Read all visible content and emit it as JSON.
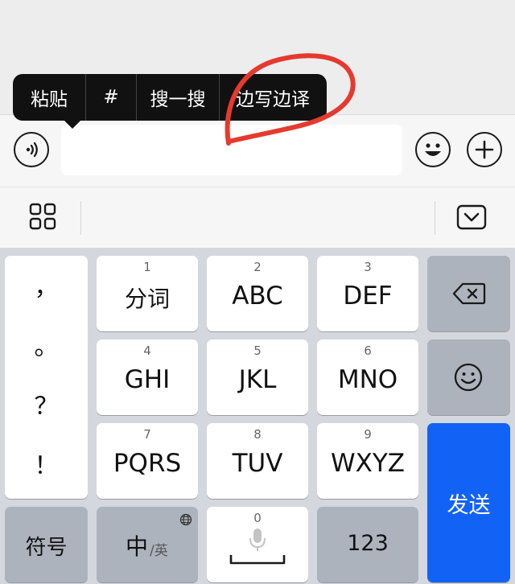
{
  "context_menu": {
    "items": [
      "粘贴",
      "#",
      "搜一搜",
      "边写边译"
    ]
  },
  "input_bar": {
    "voice_icon": "voice-icon",
    "emoji_icon": "emoji-icon",
    "add_icon": "plus-icon",
    "text_value": ""
  },
  "toolbar": {
    "grid_icon": "grid-icon",
    "collapse_icon": "keyboard-collapse-icon"
  },
  "keyboard": {
    "punctuation": [
      "，",
      "。",
      "？",
      "！"
    ],
    "keys": [
      {
        "num": "1",
        "label": "分词"
      },
      {
        "num": "2",
        "label": "ABC"
      },
      {
        "num": "3",
        "label": "DEF"
      },
      {
        "num": "4",
        "label": "GHI"
      },
      {
        "num": "5",
        "label": "JKL"
      },
      {
        "num": "6",
        "label": "MNO"
      },
      {
        "num": "7",
        "label": "PQRS"
      },
      {
        "num": "8",
        "label": "TUV"
      },
      {
        "num": "9",
        "label": "WXYZ"
      }
    ],
    "symbols_label": "符号",
    "lang_main": "中",
    "lang_sub": "/英",
    "space_num": "0",
    "numbers_label": "123",
    "send_label": "发送",
    "accent_color": "#1262f6",
    "annotation_color": "#e53a2e"
  }
}
